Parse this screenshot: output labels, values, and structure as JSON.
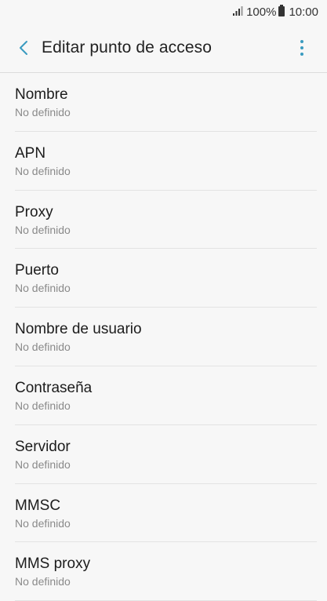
{
  "status_bar": {
    "battery": "100%",
    "time": "10:00"
  },
  "header": {
    "title": "Editar punto de acceso"
  },
  "settings": [
    {
      "label": "Nombre",
      "value": "No definido"
    },
    {
      "label": "APN",
      "value": "No definido"
    },
    {
      "label": "Proxy",
      "value": "No definido"
    },
    {
      "label": "Puerto",
      "value": "No definido"
    },
    {
      "label": "Nombre de usuario",
      "value": "No definido"
    },
    {
      "label": "Contraseña",
      "value": "No definido"
    },
    {
      "label": "Servidor",
      "value": "No definido"
    },
    {
      "label": "MMSC",
      "value": "No definido"
    },
    {
      "label": "MMS proxy",
      "value": "No definido"
    }
  ],
  "colors": {
    "accent": "#3a9bc0",
    "background": "#f7f7f7",
    "divider": "#e3e3e3",
    "secondary_text": "#8a8a8a"
  },
  "icons": {
    "signal": "signal-icon",
    "battery": "battery-icon",
    "back": "chevron-left-icon",
    "more": "more-vertical-icon"
  }
}
